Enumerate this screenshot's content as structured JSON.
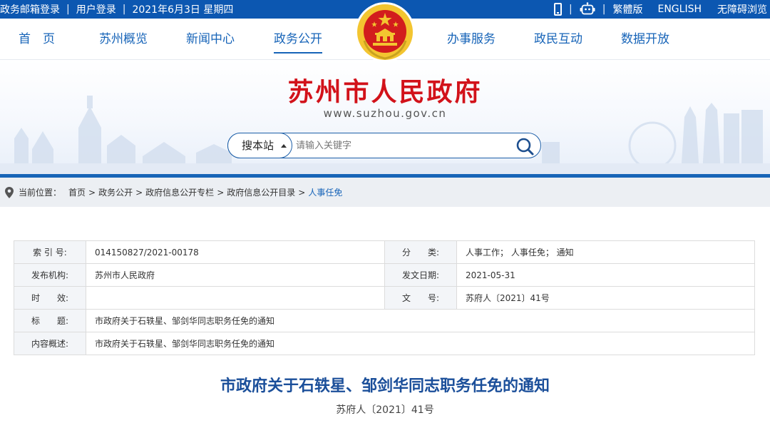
{
  "topbar": {
    "email_login": "政务邮箱登录",
    "user_login": "用户登录",
    "date": "2021年6月3日 星期四",
    "traditional": "繁體版",
    "english": "ENGLISH",
    "accessible": "无障碍浏览",
    "icons": [
      "mobile-icon",
      "robot-icon"
    ]
  },
  "nav": {
    "items": [
      "首　页",
      "苏州概览",
      "新闻中心",
      "政务公开",
      "办事服务",
      "政民互动",
      "数据开放"
    ],
    "active_index": 3
  },
  "header": {
    "title": "苏州市人民政府",
    "url": "www.suzhou.gov.cn"
  },
  "search": {
    "scope": "搜本站",
    "placeholder": "请输入关键字"
  },
  "breadcrumb": {
    "label": "当前位置：",
    "items": [
      "首页",
      "政务公开",
      "政府信息公开专栏",
      "政府信息公开目录",
      "人事任免"
    ]
  },
  "info": {
    "index_label": "索 引 号:",
    "index_value": "014150827/2021-00178",
    "category_label": "分　　类:",
    "category_value": "人事工作；  人事任免；  通知",
    "issuer_label": "发布机构:",
    "issuer_value": "苏州市人民政府",
    "date_label": "发文日期:",
    "date_value": "2021-05-31",
    "validity_label": "时　　效:",
    "validity_value": "",
    "docno_label": "文　　号:",
    "docno_value": "苏府人〔2021〕41号",
    "title_label": "标　　题:",
    "title_value": "市政府关于石轶星、邹剑华同志职务任免的通知",
    "summary_label": "内容概述:",
    "summary_value": "市政府关于石轶星、邹剑华同志职务任免的通知"
  },
  "document": {
    "title": "市政府关于石轶星、邹剑华同志职务任免的通知",
    "number": "苏府人〔2021〕41号"
  },
  "colors": {
    "primary_blue": "#1764b8",
    "top_bar": "#0c57b1",
    "title_red": "#d2121a",
    "emblem_gold": "#f3c530"
  }
}
